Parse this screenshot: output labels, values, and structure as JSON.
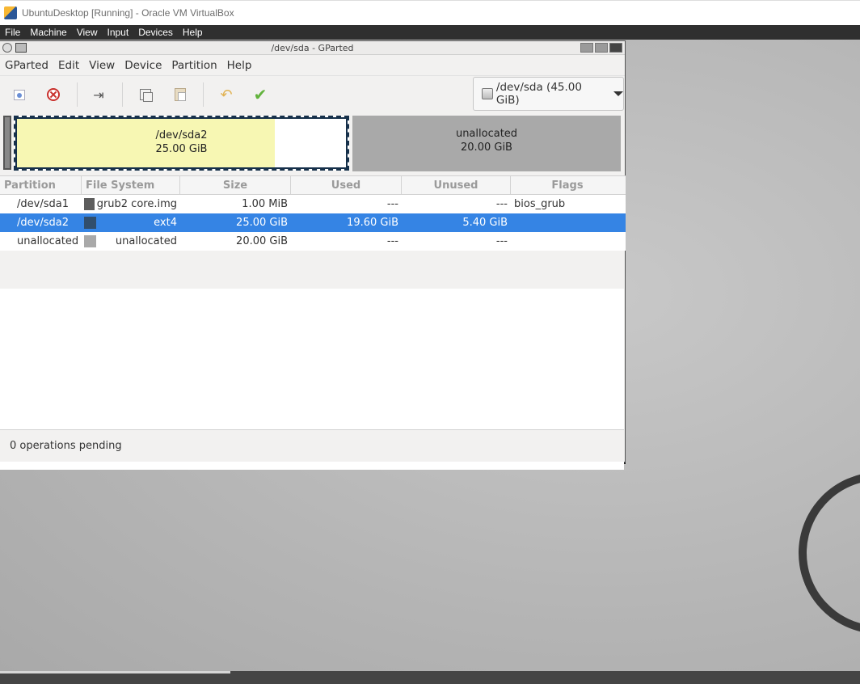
{
  "host": {
    "title": "UbuntuDesktop [Running] - Oracle VM VirtualBox",
    "menu": [
      "File",
      "Machine",
      "View",
      "Input",
      "Devices",
      "Help"
    ]
  },
  "gparted": {
    "title": "/dev/sda - GParted",
    "menu": [
      "GParted",
      "Edit",
      "View",
      "Device",
      "Partition",
      "Help"
    ],
    "toolbar": {
      "icons": [
        "new-partition-icon",
        "delete-partition-icon",
        "resize-move-icon",
        "copy-icon",
        "paste-icon",
        "undo-icon",
        "apply-icon"
      ]
    },
    "device_selector": "/dev/sda (45.00 GiB)",
    "disk_visual": {
      "sda2": {
        "name": "/dev/sda2",
        "size": "25.00 GiB",
        "used_fraction": 0.784
      },
      "unallocated": {
        "name": "unallocated",
        "size": "20.00 GiB"
      }
    },
    "columns": [
      "Partition",
      "File System",
      "Size",
      "Used",
      "Unused",
      "Flags"
    ],
    "rows": [
      {
        "partition": "/dev/sda1",
        "fs": "grub2 core.img",
        "fs_color": "#5d5d5d",
        "size": "1.00 MiB",
        "used": "---",
        "unused": "---",
        "flags": "bios_grub",
        "selected": false
      },
      {
        "partition": "/dev/sda2",
        "fs": "ext4",
        "fs_color": "#314e6c",
        "size": "25.00 GiB",
        "used": "19.60 GiB",
        "unused": "5.40 GiB",
        "flags": "",
        "selected": true
      },
      {
        "partition": "unallocated",
        "fs": "unallocated",
        "fs_color": "#a9a9a9",
        "size": "20.00 GiB",
        "used": "---",
        "unused": "---",
        "flags": "",
        "selected": false
      }
    ],
    "status": "0 operations pending"
  }
}
